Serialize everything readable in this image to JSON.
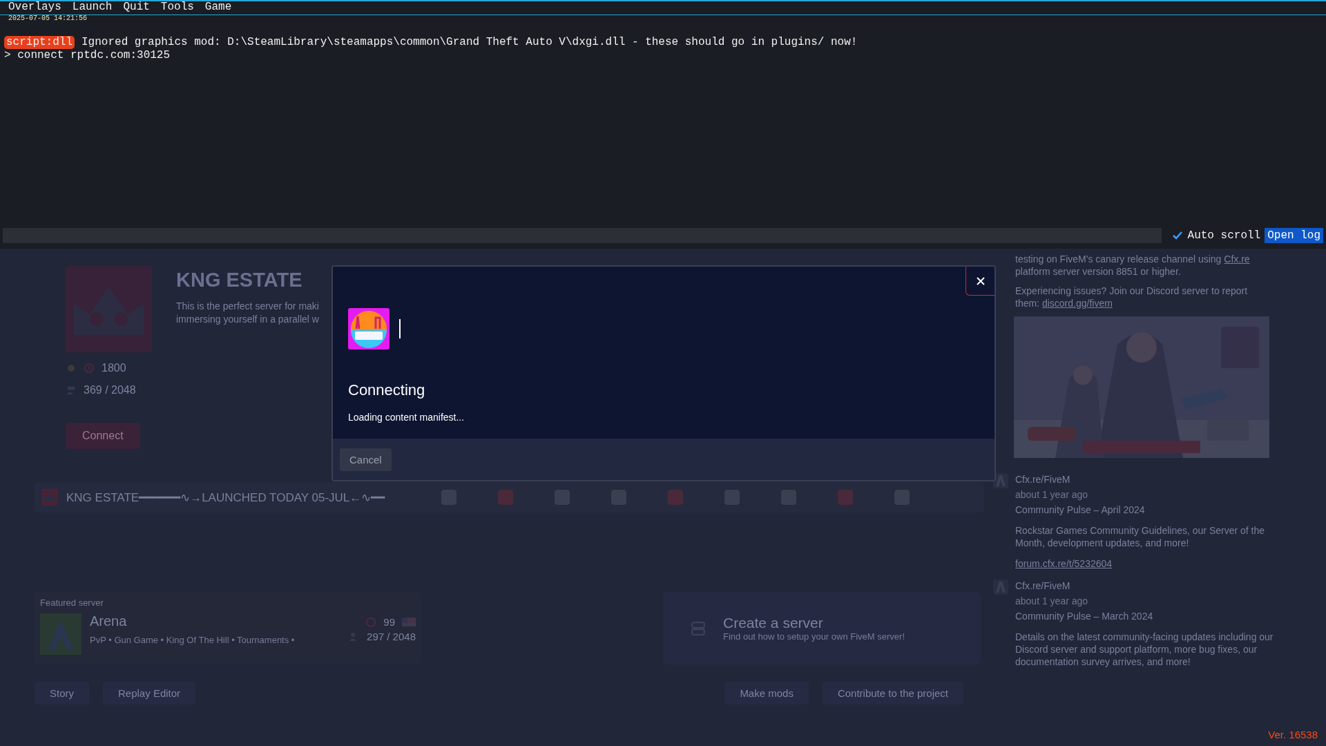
{
  "menu_bar": {
    "items": [
      "Overlays",
      "Launch",
      "Quit",
      "Tools",
      "Game"
    ],
    "timestamp": "2025-07-05 14:21:56"
  },
  "console": {
    "lines": [
      {
        "kind": "tagged",
        "tag": "script:dll",
        "text": "Ignored graphics mod: D:\\SteamLibrary\\steamapps\\common\\Grand Theft Auto V\\dxgi.dll - these should go in plugins/ now!"
      },
      {
        "kind": "plain",
        "text": "> connect rptdc.com:30125"
      }
    ],
    "auto_scroll": {
      "label": "Auto scroll",
      "checked": true
    },
    "open_log": "Open log"
  },
  "server": {
    "title": "KNG ESTATE",
    "description": [
      "This is the perfect server for maki",
      "immersing yourself in a parallel w"
    ],
    "uptime": "1800",
    "players": "369 / 2048",
    "connect": "Connect"
  },
  "banner": {
    "text": "KNG ESTATE━━━━━━∿→LAUNCHED TODAY 05-JUL←∿━━"
  },
  "featured": {
    "label": "Featured server",
    "name": "Arena",
    "tags": "PvP • Gun Game • King Of The Hill • Tournaments • ",
    "uptime": "99",
    "players": "297 / 2048"
  },
  "create_server": {
    "title": "Create a server",
    "subtitle": "Find out how to setup your own FiveM server!"
  },
  "actions_left": [
    "Story",
    "Replay Editor"
  ],
  "actions_right": [
    "Make mods",
    "Contribute to the project"
  ],
  "news": {
    "intro": [
      {
        "before": "testing on FiveM's canary release channel using ",
        "link": "Cfx.re",
        "after": " platform server version 8851 or higher."
      },
      {
        "before": "Experiencing issues? Join our Discord server to report them: ",
        "link": "discord.gg/fivem"
      }
    ],
    "posts": [
      {
        "author": "Cfx.re/FiveM",
        "time": "about 1 year ago",
        "title": "Community Pulse – April 2024",
        "body": "Rockstar Games Community Guidelines, our Server of the Month, development updates, and more!",
        "link": "forum.cfx.re/t/5232604"
      },
      {
        "author": "Cfx.re/FiveM",
        "time": "about 1 year ago",
        "title": "Community Pulse – March 2024",
        "body": "Details on the latest community-facing updates including our Discord server and support platform, more bug fixes, our documentation survey arrives, and more!"
      }
    ]
  },
  "version": "Ver. 16538",
  "dialog": {
    "title": "Connecting",
    "status": "Loading content manifest...",
    "cancel": "Cancel"
  }
}
